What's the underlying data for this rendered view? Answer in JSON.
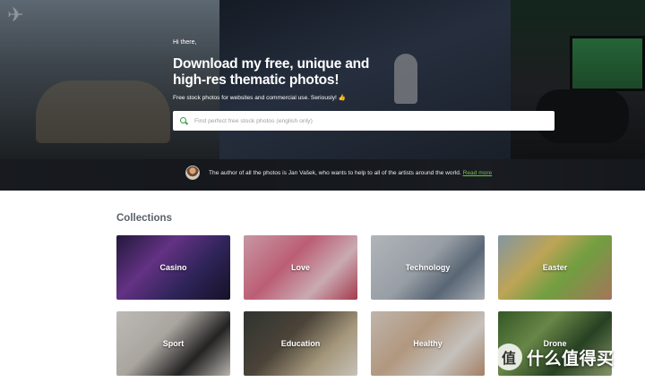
{
  "hero": {
    "greeting": "Hi there,",
    "title_line1": "Download my free, unique and",
    "title_line2": "high-res thematic photos!",
    "subtitle": "Free stock photos for websites and commercial use. Seriously! 👍"
  },
  "search": {
    "placeholder": "Find perfect free stock photos (english only)",
    "icon": "search-icon"
  },
  "author_bar": {
    "text": "The author of all the photos is Jan Vašek, who wants to help to all of the artists around the world.",
    "link_label": "Read more"
  },
  "collections": {
    "title": "Collections",
    "items": [
      {
        "label": "Casino"
      },
      {
        "label": "Love"
      },
      {
        "label": "Technology"
      },
      {
        "label": "Easter"
      },
      {
        "label": "Sport"
      },
      {
        "label": "Education"
      },
      {
        "label": "Healthy"
      },
      {
        "label": "Drone"
      }
    ]
  },
  "watermark": {
    "badge": "值",
    "text": "什么值得买"
  },
  "colors": {
    "accent_green": "#6cc24a",
    "author_bar_bg": "#14161a",
    "collections_title": "#5a626a"
  }
}
